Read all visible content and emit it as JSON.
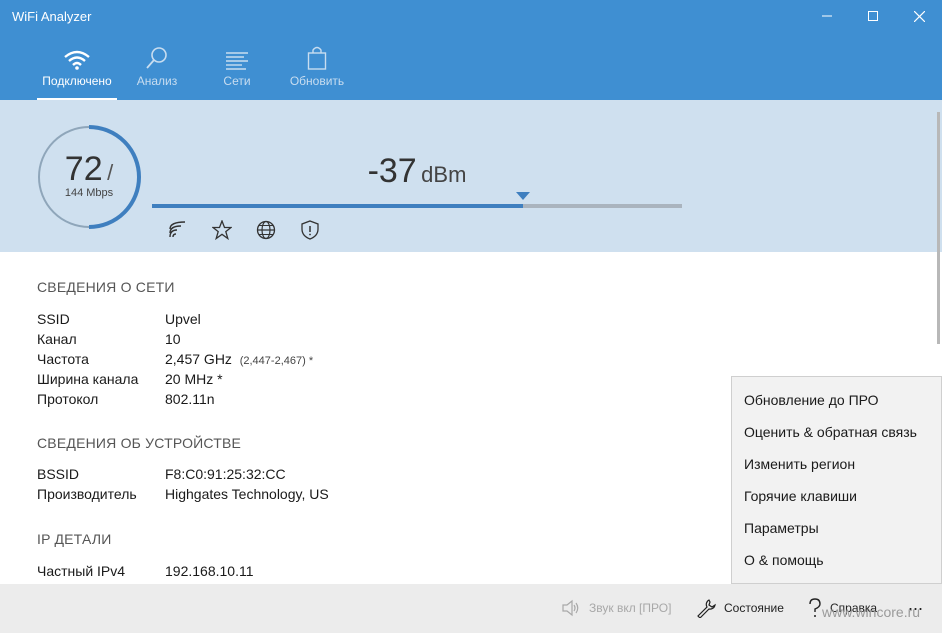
{
  "app": {
    "title": "WiFi Analyzer"
  },
  "nav": {
    "tabs": [
      {
        "label": "Подключено",
        "icon": "wifi-icon",
        "active": true
      },
      {
        "label": "Анализ",
        "icon": "magnifier-icon",
        "active": false
      },
      {
        "label": "Сети",
        "icon": "list-icon",
        "active": false
      },
      {
        "label": "Обновить",
        "icon": "shopping-bag-icon",
        "active": false
      }
    ]
  },
  "signal": {
    "link_speed": "72",
    "slash": "/",
    "max_speed": "144 Mbps",
    "speed_fraction": 0.5,
    "dbm_value": "-37",
    "dbm_unit": "dBm",
    "strength_fraction": 0.7,
    "icons": [
      "signal-strength-icon",
      "star-icon",
      "globe-icon",
      "shield-icon"
    ]
  },
  "network": {
    "heading": "СВЕДЕНИЯ О СЕТИ",
    "rows": [
      {
        "key": "SSID",
        "value": "Upvel"
      },
      {
        "key": "Канал",
        "value": "10"
      },
      {
        "key": "Частота",
        "value": "2,457 GHz",
        "extra": "(2,447-2,467) *"
      },
      {
        "key": "Ширина канала",
        "value": "20 MHz *"
      },
      {
        "key": "Протокол",
        "value": "802.11n"
      }
    ]
  },
  "device": {
    "heading": "СВЕДЕНИЯ ОБ УСТРОЙСТВЕ",
    "rows": [
      {
        "key": "BSSID",
        "value": "F8:C0:91:25:32:CC"
      },
      {
        "key": "Производитель",
        "value": "Highgates Technology, US"
      }
    ]
  },
  "ip": {
    "heading": "IP ДЕТАЛИ",
    "rows": [
      {
        "key": "Частный IPv4",
        "value": "192.168.10.11"
      }
    ]
  },
  "menu": {
    "items": [
      "Обновление до ПРО",
      "Оценить & обратная связь",
      "Изменить регион",
      "Горячие клавиши",
      "Параметры",
      "О & помощь"
    ]
  },
  "bottombar": {
    "sound": "Звук вкл [ПРО]",
    "status": "Состояние",
    "help": "Справка",
    "more": "..."
  },
  "watermark": "www.wincore.ru",
  "colors": {
    "accent": "#3f8fd2",
    "signal_bg": "#cfe0ef",
    "bar_fill": "#3f7fbf"
  }
}
